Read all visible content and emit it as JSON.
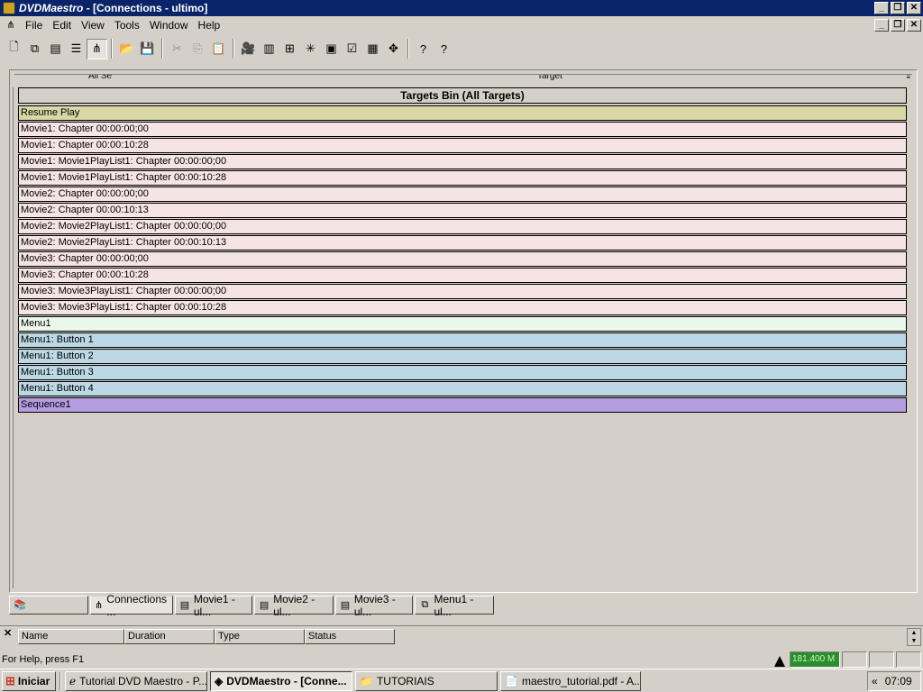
{
  "window": {
    "app_name": "DVDMaestro",
    "doc_title": " - [Connections - ultimo]"
  },
  "menu": [
    "File",
    "Edit",
    "View",
    "Tools",
    "Window",
    "Help"
  ],
  "toolbar": {
    "buttons": [
      {
        "name": "new-icon",
        "glyph": "🗋"
      },
      {
        "name": "connections-icon",
        "glyph": "⧉"
      },
      {
        "name": "movie-icon",
        "glyph": "▤"
      },
      {
        "name": "list-icon",
        "glyph": "☰"
      },
      {
        "name": "network-icon",
        "glyph": "⋔",
        "pressed": true
      },
      {
        "name": "open-icon",
        "glyph": "📂"
      },
      {
        "name": "save-icon",
        "glyph": "💾"
      },
      {
        "name": "cut-icon",
        "glyph": "✂",
        "dim": true
      },
      {
        "name": "copy-icon",
        "glyph": "⎘",
        "dim": true
      },
      {
        "name": "paste-icon",
        "glyph": "📋"
      },
      {
        "name": "camera-icon",
        "glyph": "🎥"
      },
      {
        "name": "barcode-icon",
        "glyph": "▥"
      },
      {
        "name": "layout-icon",
        "glyph": "⊞"
      },
      {
        "name": "star-icon",
        "glyph": "✳"
      },
      {
        "name": "film-icon",
        "glyph": "▣"
      },
      {
        "name": "check-icon",
        "glyph": "☑"
      },
      {
        "name": "chart-icon",
        "glyph": "▦"
      },
      {
        "name": "move-icon",
        "glyph": "✥"
      },
      {
        "name": "help-icon",
        "glyph": "?"
      },
      {
        "name": "context-help-icon",
        "glyph": "?"
      }
    ]
  },
  "bin": {
    "header_left": "All Se",
    "header_right": "Target",
    "title": "Targets Bin (All Targets)",
    "targets": [
      {
        "label": "Resume Play",
        "color": "#d8d8a6"
      },
      {
        "label": "Movie1: Chapter 00:00:00;00",
        "color": "#f6e4e4"
      },
      {
        "label": "Movie1: Chapter 00:00:10:28",
        "color": "#f6e4e4"
      },
      {
        "label": "Movie1: Movie1PlayList1: Chapter 00:00:00;00",
        "color": "#f6e4e4"
      },
      {
        "label": "Movie1: Movie1PlayList1: Chapter 00:00:10:28",
        "color": "#f6e4e4"
      },
      {
        "label": "Movie2: Chapter 00:00:00;00",
        "color": "#f6e4e4"
      },
      {
        "label": "Movie2: Chapter 00:00:10:13",
        "color": "#f6e4e4"
      },
      {
        "label": "Movie2: Movie2PlayList1: Chapter 00:00:00;00",
        "color": "#f6e4e4"
      },
      {
        "label": "Movie2: Movie2PlayList1: Chapter 00:00:10:13",
        "color": "#f6e4e4"
      },
      {
        "label": "Movie3: Chapter 00:00:00;00",
        "color": "#f6e4e4"
      },
      {
        "label": "Movie3: Chapter 00:00:10:28",
        "color": "#f6e4e4"
      },
      {
        "label": "Movie3: Movie3PlayList1: Chapter 00:00:00;00",
        "color": "#f6e4e4"
      },
      {
        "label": "Movie3: Movie3PlayList1: Chapter 00:00:10:28",
        "color": "#f6e4e4"
      },
      {
        "label": "Menu1",
        "color": "#e9f8e9"
      },
      {
        "label": "Menu1: Button 1",
        "color": "#bcd8e6"
      },
      {
        "label": "Menu1: Button 2",
        "color": "#bcd8e6"
      },
      {
        "label": "Menu1: Button 3",
        "color": "#bcd8e6"
      },
      {
        "label": "Menu1: Button 4",
        "color": "#bcd8e6"
      },
      {
        "label": "Sequence1",
        "color": "#b49ce0"
      }
    ]
  },
  "tabs": [
    {
      "label": "",
      "icon": "library-icon",
      "glyph": "📚",
      "width": 88
    },
    {
      "label": "Connections ...",
      "icon": "connections-tab-icon",
      "glyph": "⋔",
      "active": true,
      "width": 92
    },
    {
      "label": "Movie1 - ul...",
      "icon": "movie-tab-icon",
      "glyph": "▤",
      "width": 86
    },
    {
      "label": "Movie2 - ul...",
      "icon": "movie-tab-icon",
      "glyph": "▤",
      "width": 88
    },
    {
      "label": "Movie3 - ul...",
      "icon": "movie-tab-icon",
      "glyph": "▤",
      "width": 86
    },
    {
      "label": "Menu1 - ul...",
      "icon": "menu-tab-icon",
      "glyph": "⧉",
      "width": 88
    }
  ],
  "output": {
    "columns": [
      "Name",
      "Duration",
      "Type",
      "Status"
    ]
  },
  "status": {
    "help_text": "For Help, press F1",
    "disk_free": "181.400 M"
  },
  "taskbar": {
    "start_label": "Iniciar",
    "tasks": [
      {
        "label": "Tutorial DVD Maestro - P...",
        "icon": "ie-icon",
        "glyph": "ℯ"
      },
      {
        "label": "DVDMaestro - [Conne...",
        "icon": "dvdmaestro-icon",
        "glyph": "◈",
        "active": true
      },
      {
        "label": "TUTORIAIS",
        "icon": "folder-icon",
        "glyph": "📁"
      },
      {
        "label": "maestro_tutorial.pdf - A...",
        "icon": "pdf-icon",
        "glyph": "📄"
      }
    ],
    "clock": "07:09"
  }
}
